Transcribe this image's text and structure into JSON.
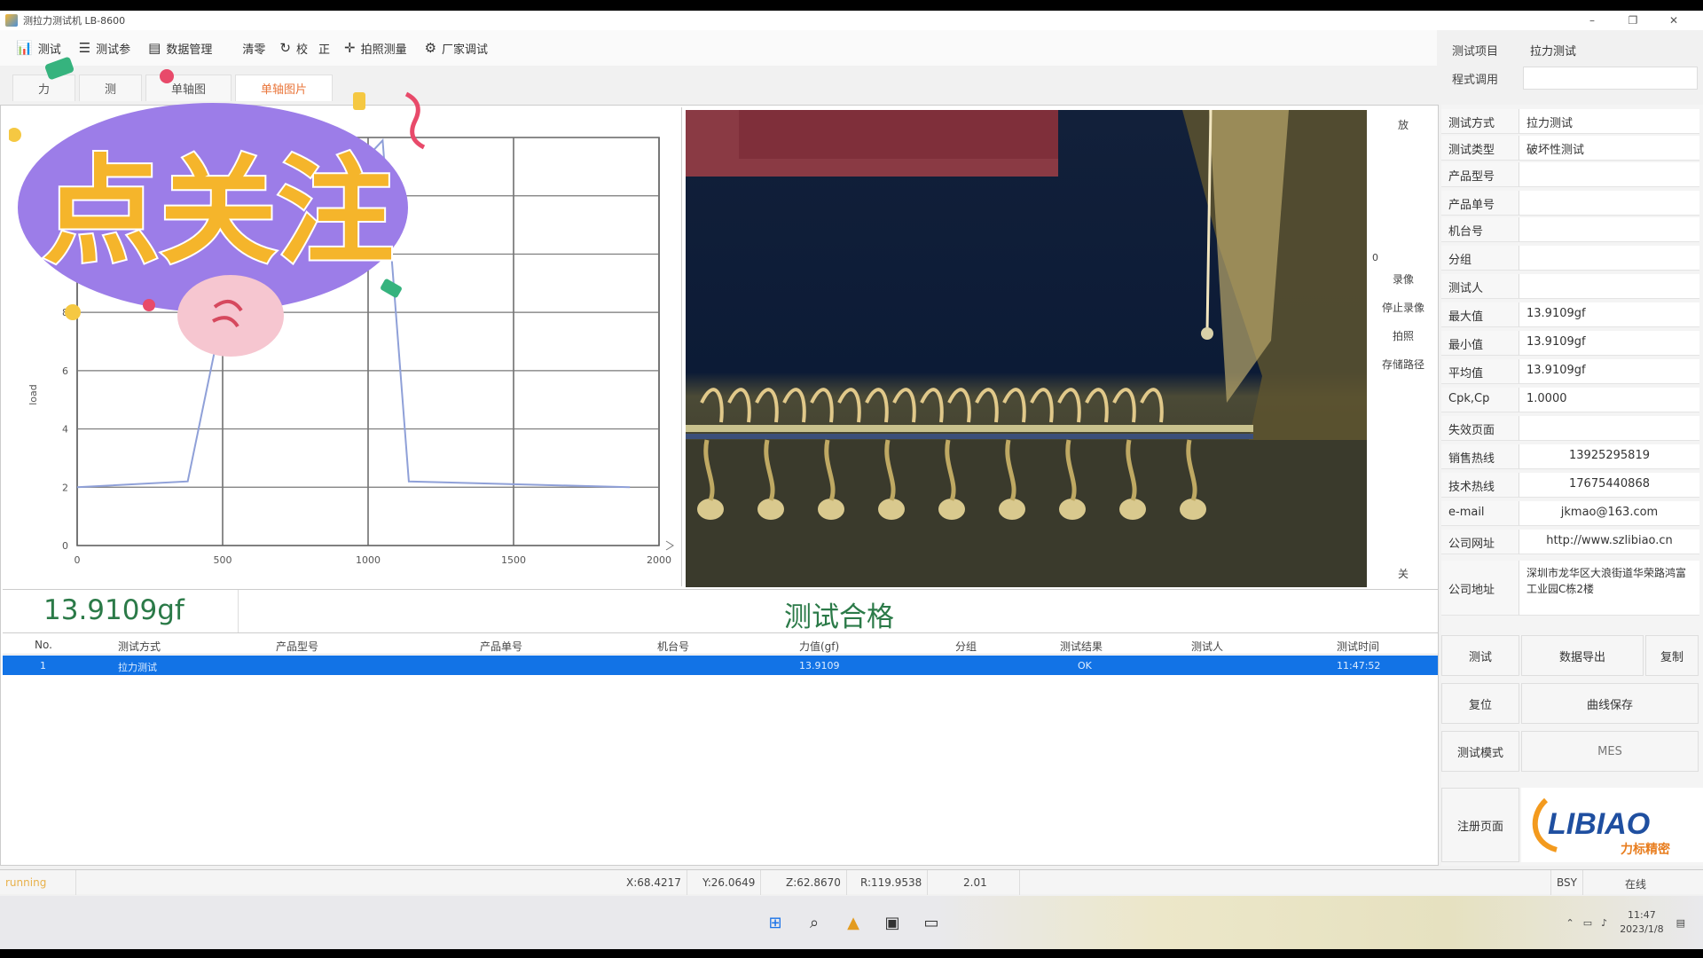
{
  "app": {
    "title": "测拉力测试机 LB-8600",
    "window_controls": [
      "–",
      "❐",
      "✕"
    ]
  },
  "toolbar": {
    "items": [
      {
        "label": "测试",
        "icon": "chart-icon"
      },
      {
        "label": "测试参",
        "icon": "sliders-icon"
      },
      {
        "label": "数据管理",
        "icon": "database-icon"
      },
      {
        "label": "清零",
        "icon": ""
      },
      {
        "label": "校",
        "icon": "refresh-icon"
      },
      {
        "label": "正",
        "icon": ""
      },
      {
        "label": "拍照测量",
        "icon": "crosshair-icon"
      },
      {
        "label": "厂家调试",
        "icon": "wrench-icon"
      }
    ]
  },
  "header_fields": {
    "test_item_label": "测试项目",
    "test_item_value": "拉力测试",
    "program_label": "程式调用",
    "program_value": ""
  },
  "tabs": [
    "力",
    "测",
    "单轴图",
    "单轴图片"
  ],
  "chart_data": {
    "type": "line",
    "x_ticks": [
      "0",
      "500",
      "1000",
      "1500",
      "2000"
    ],
    "y_ticks": [
      "0",
      "2",
      "4",
      "6",
      "8"
    ],
    "ylabel": "load",
    "xlim": [
      0,
      2000
    ],
    "ylim": [
      0,
      14
    ],
    "grid": true,
    "series": [
      {
        "x": [
          0,
          380,
          500,
          1050,
          1140,
          1900
        ],
        "y": [
          2.0,
          2.2,
          8.0,
          13.9,
          2.2,
          2.0
        ]
      }
    ]
  },
  "side_strip": {
    "top": "放",
    "record": "录像",
    "stop_record": "停止录像",
    "capture": "拍照",
    "save_path": "存储路径",
    "zero": "0",
    "bottom": "关"
  },
  "result": {
    "reading": "13.9109gf",
    "verdict": "测试合格"
  },
  "table": {
    "columns": [
      "No.",
      "测试方式",
      "产品型号",
      "产品单号",
      "机台号",
      "力值(gf)",
      "分组",
      "测试结果",
      "测试人",
      "测试时间"
    ],
    "rows": [
      [
        "1",
        "拉力测试",
        "",
        "",
        "",
        "13.9109",
        "",
        "OK",
        "",
        "11:47:52"
      ]
    ]
  },
  "right_panel": {
    "fields": [
      {
        "label": "测试方式",
        "value": "拉力测试"
      },
      {
        "label": "测试类型",
        "value": "破坏性测试"
      },
      {
        "label": "产品型号",
        "value": ""
      },
      {
        "label": "产品单号",
        "value": ""
      },
      {
        "label": "机台号",
        "value": ""
      },
      {
        "label": "分组",
        "value": ""
      },
      {
        "label": "测试人",
        "value": ""
      },
      {
        "label": "最大值",
        "value": "13.9109gf"
      },
      {
        "label": "最小值",
        "value": "13.9109gf"
      },
      {
        "label": "平均值",
        "value": "13.9109gf"
      },
      {
        "label": "Cpk,Cp",
        "value": "1.0000"
      },
      {
        "label": "失效页面",
        "value": ""
      },
      {
        "label": "销售热线",
        "value": "13925295819"
      },
      {
        "label": "技术热线",
        "value": "17675440868"
      },
      {
        "label": "e-mail",
        "value": "jkmao@163.com"
      },
      {
        "label": "公司网址",
        "value": "http://www.szlibiao.cn"
      }
    ],
    "address_label": "公司地址",
    "address_value": "深圳市龙华区大浪街道华荣路鸿富工业园C栋2楼",
    "buttons": {
      "test": "测试",
      "export": "数据导出",
      "copy": "复制",
      "reset": "复位",
      "curve_save": "曲线保存",
      "test_mode": "测试模式",
      "mes": "MES",
      "register": "注册页面"
    },
    "logo_text": "LIBIAO",
    "logo_sub": "力标精密"
  },
  "statusbar": {
    "left": "running",
    "x": "X:68.4217",
    "y": "Y:26.0649",
    "z": "Z:62.8670",
    "r": "R:119.9538",
    "val": "2.01",
    "bsy": "BSY",
    "online": "在线"
  },
  "taskbar": {
    "time": "11:47",
    "date": "2023/1/8"
  },
  "sticker": {
    "text": "点关注"
  },
  "colors": {
    "accent_blue": "#1273e6",
    "pass_green": "#2b7a48",
    "sticker_yellow": "#f5b52b",
    "sticker_purple": "#9c7de8"
  }
}
